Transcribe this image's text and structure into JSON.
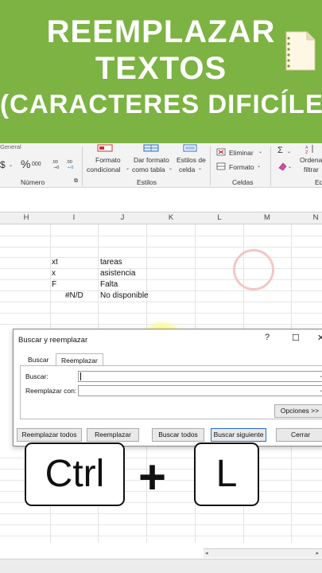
{
  "banner": {
    "line1": "REEMPLAZAR",
    "line2": "TEXTOS",
    "line3": "(CARACTERES DIFICÍLES)"
  },
  "ribbon": {
    "number_format": "General",
    "currency": "$",
    "percent": "%",
    "thousands": "000",
    "number_group": "Número",
    "styles": {
      "conditional_l1": "Formato",
      "conditional_l2": "condicional",
      "table_l1": "Dar formato",
      "table_l2": "como tabla",
      "cell_l1": "Estilos de",
      "cell_l2": "celda",
      "group": "Estilos"
    },
    "cells": {
      "delete": "Eliminar",
      "format": "Formato",
      "group": "Celdas"
    },
    "editing": {
      "sort_l1": "Ordena",
      "sort_l2": "filtrar",
      "group": "Ed"
    }
  },
  "sheet": {
    "columns": [
      "H",
      "I",
      "J",
      "K",
      "L",
      "M",
      "N"
    ],
    "rows": [
      {
        "i": "xt",
        "j": "tareas"
      },
      {
        "i": "x",
        "j": "asistencia"
      },
      {
        "i": "F",
        "j": "Falta"
      },
      {
        "i": "#N/D",
        "j": "No disponible"
      }
    ]
  },
  "dialog": {
    "title": "Buscar y reemplazar",
    "tabs": [
      "Buscar",
      "Reemplazar"
    ],
    "active_tab": "Reemplazar",
    "find_label": "Buscar:",
    "replace_label": "Reemplazar con:",
    "find_value": "",
    "replace_value": "",
    "options_button": "Opciones >>",
    "buttons": {
      "replace_all": "Reemplazar todos",
      "replace": "Reemplazar",
      "find_all": "Buscar todos",
      "find_next": "Buscar siguiente",
      "close": "Cerrar"
    }
  },
  "shortcut": {
    "key1": "Ctrl",
    "plus": "+",
    "key2": "L"
  },
  "colors": {
    "banner_green": "#7cb342",
    "accent_blue": "#2b6cc4"
  }
}
